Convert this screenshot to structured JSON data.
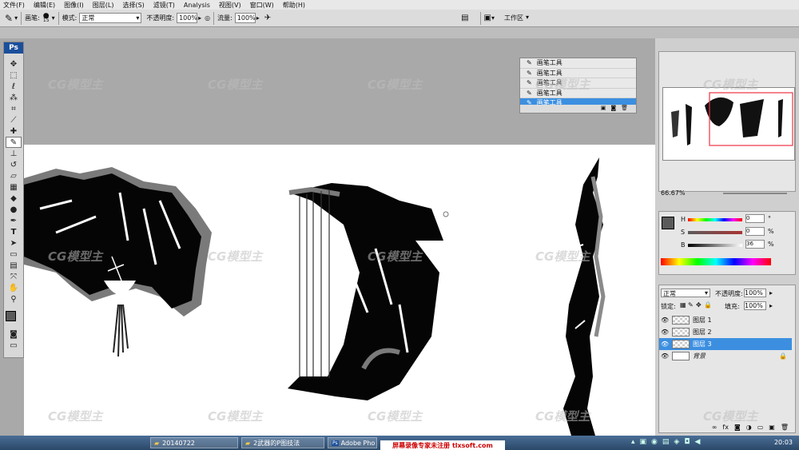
{
  "menu": [
    "文件(F)",
    "编辑(E)",
    "图像(I)",
    "图层(L)",
    "选择(S)",
    "滤镜(T)",
    "Analysis",
    "视图(V)",
    "窗口(W)",
    "帮助(H)"
  ],
  "options": {
    "brush_label": "画笔:",
    "brush_size": "15",
    "mode_label": "模式:",
    "mode_value": "正常",
    "opacity_label": "不透明度:",
    "opacity_value": "100%",
    "flow_label": "流量:",
    "flow_value": "100%",
    "workspace": "工作区"
  },
  "history": [
    "画笔工具",
    "画笔工具",
    "画笔工具",
    "画笔工具",
    "画笔工具"
  ],
  "history_selected": 4,
  "navigator": {
    "zoom": "66.67%"
  },
  "color": {
    "h_label": "H",
    "h_value": "0",
    "h_unit": "°",
    "s_label": "S",
    "s_value": "0",
    "s_unit": "%",
    "b_label": "B",
    "b_value": "36",
    "b_unit": "%",
    "foreground": "#5b5b5b"
  },
  "layers": {
    "blend_mode": "正常",
    "opacity_label": "不透明度:",
    "opacity_value": "100%",
    "lock_label": "锁定:",
    "fill_label": "填充:",
    "fill_value": "100%",
    "items": [
      {
        "name": "图层 1"
      },
      {
        "name": "图层 2"
      },
      {
        "name": "图层 3"
      },
      {
        "name": "背景"
      }
    ],
    "selected": 2
  },
  "taskbar": {
    "items": [
      "20140722",
      "2武器的P图技法",
      "Adobe Pho"
    ],
    "banner": "屏幕录像专家未注册 tlxsoft.com",
    "time": "20:03"
  },
  "watermark": "CG模型主",
  "accent": "#3c8fe0"
}
